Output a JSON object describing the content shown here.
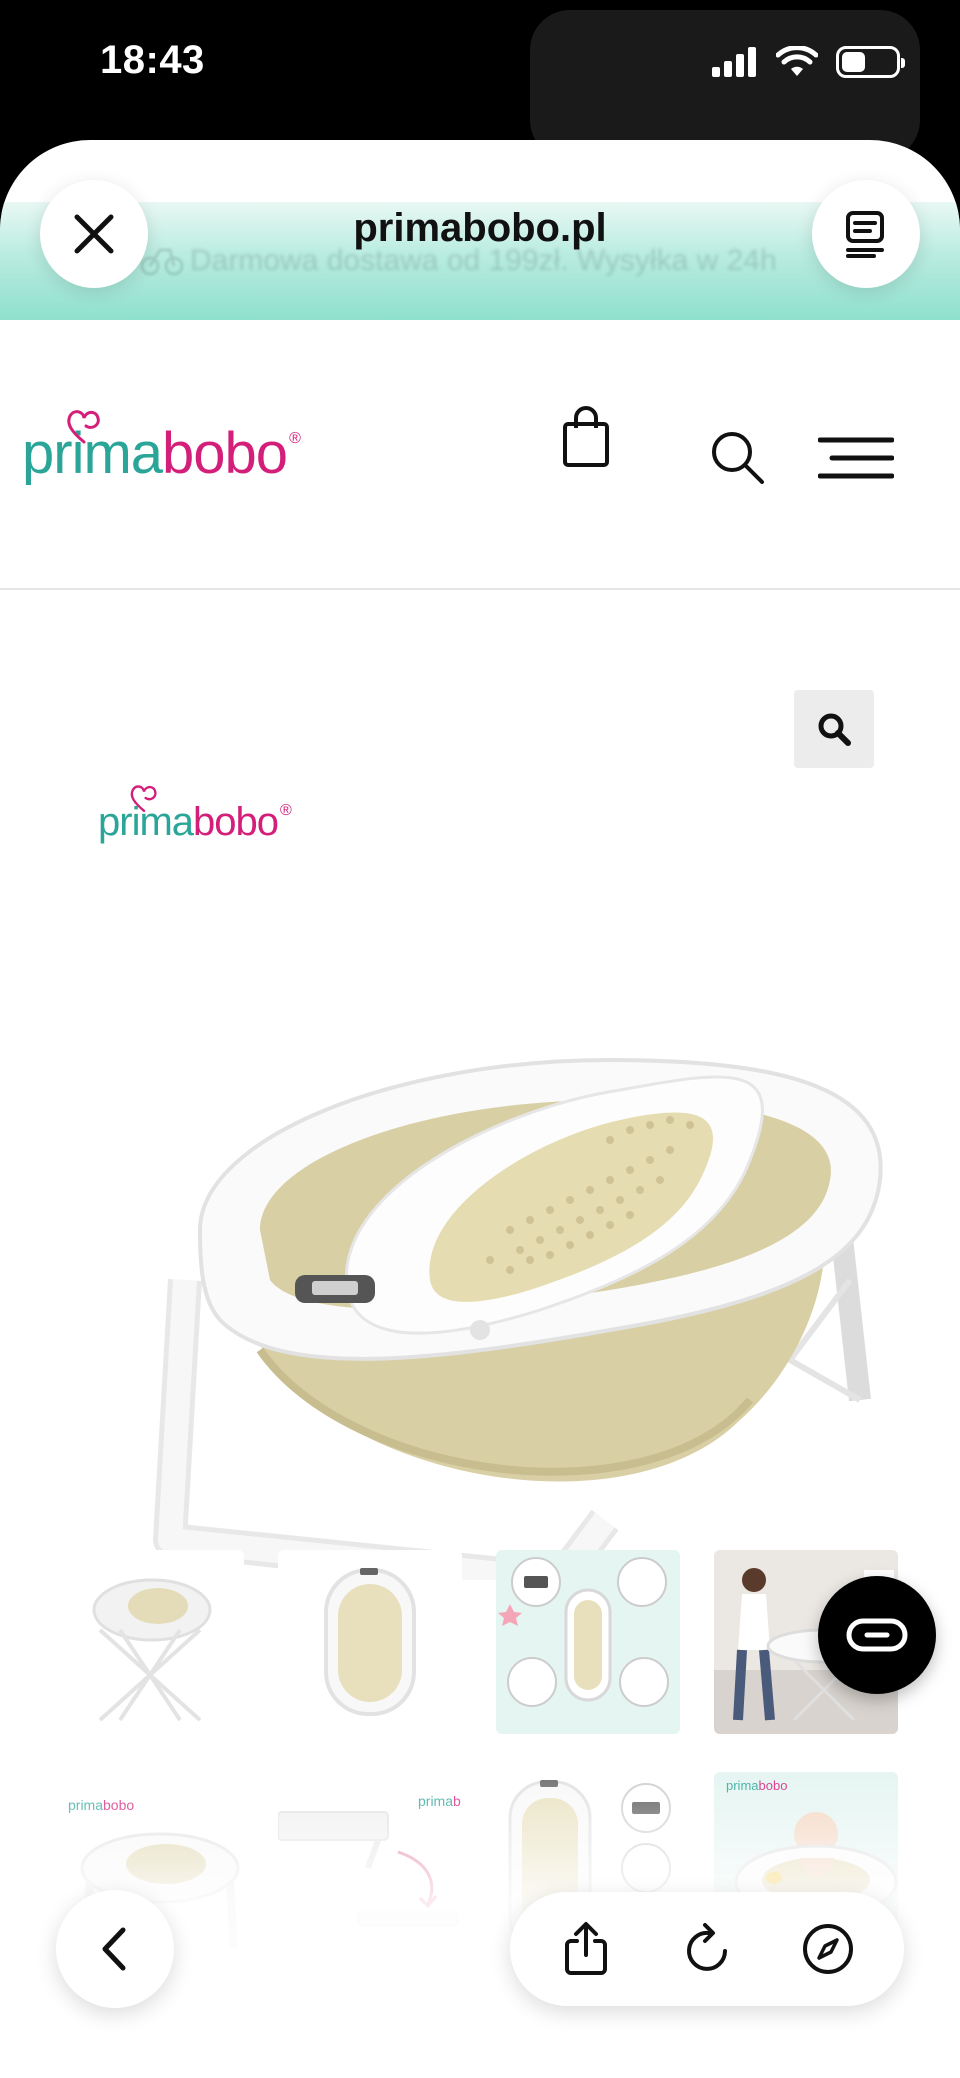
{
  "status_bar": {
    "time": "18:43",
    "battery_level": 0.45
  },
  "browser": {
    "url": "primabobo.pl",
    "promo_text": "Darmowa dostawa od 199zł. Wysyłka w 24h",
    "close_icon": "close-icon",
    "reader_icon": "reader-mode-icon"
  },
  "site": {
    "logo": {
      "part1": "prima",
      "part2": "bobo",
      "reg": "®"
    },
    "icons": [
      "shopping-bag-icon",
      "search-icon",
      "hamburger-menu-icon"
    ]
  },
  "product": {
    "zoom_icon": "magnifier-icon",
    "image_logo": {
      "part1": "prima",
      "part2": "bobo",
      "reg": "®"
    },
    "thumbnails": [
      {
        "label": "bath-on-stand"
      },
      {
        "label": "bath-top-view"
      },
      {
        "label": "bath-features-infographic"
      },
      {
        "label": "woman-with-bath"
      },
      {
        "label": "bath-with-logo"
      },
      {
        "label": "bath-folding"
      },
      {
        "label": "bath-details"
      },
      {
        "label": "baby-in-bath"
      }
    ]
  },
  "toolbar": {
    "icons": [
      "back-icon",
      "share-icon",
      "reload-icon",
      "compass-icon"
    ]
  },
  "colors": {
    "teal": "#2aa598",
    "pink": "#d41f7a",
    "tub_beige": "#d9cfa5",
    "promo_green": "#8fe0cd"
  }
}
